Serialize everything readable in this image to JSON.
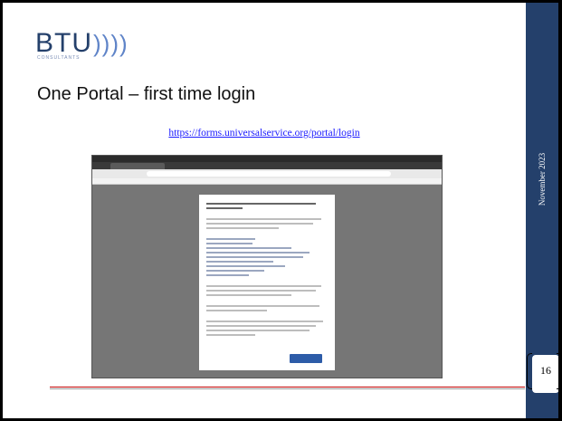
{
  "logo": {
    "text": "BTU",
    "waves": "))))",
    "tagline": "CONSULTANTS"
  },
  "slide": {
    "title": "One Portal – first time login",
    "link": "https://forms.universalservice.org/portal/login",
    "date": "November 2023",
    "page_number": "16"
  },
  "colors": {
    "band": "#24406b",
    "accent_red": "#c00000",
    "link": "#1a1aff"
  }
}
